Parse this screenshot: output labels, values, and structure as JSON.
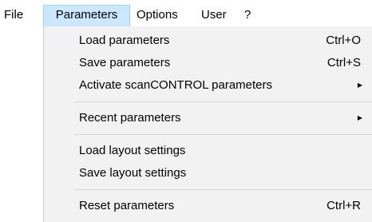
{
  "menubar": {
    "items": [
      {
        "label": "File"
      },
      {
        "label": "Parameters"
      },
      {
        "label": "Options"
      },
      {
        "label": "User"
      },
      {
        "label": "?"
      }
    ],
    "active_index": 1
  },
  "dropdown": {
    "items": [
      {
        "label": "Load parameters",
        "shortcut": "Ctrl+O"
      },
      {
        "label": "Save parameters",
        "shortcut": "Ctrl+S"
      },
      {
        "label": "Activate scanCONTROL parameters",
        "submenu_icon": "triangle-right-icon"
      },
      {
        "label": "Recent parameters",
        "submenu_icon": "triangle-right-icon"
      },
      {
        "label": "Load layout settings"
      },
      {
        "label": "Save layout settings"
      },
      {
        "label": "Reset parameters",
        "shortcut": "Ctrl+R"
      }
    ]
  },
  "colors": {
    "menu_background": "#f2f2f2",
    "active_menu_highlight": "#cce8ff",
    "active_menu_border": "#99d1ff",
    "separator": "#d6d6d6"
  }
}
